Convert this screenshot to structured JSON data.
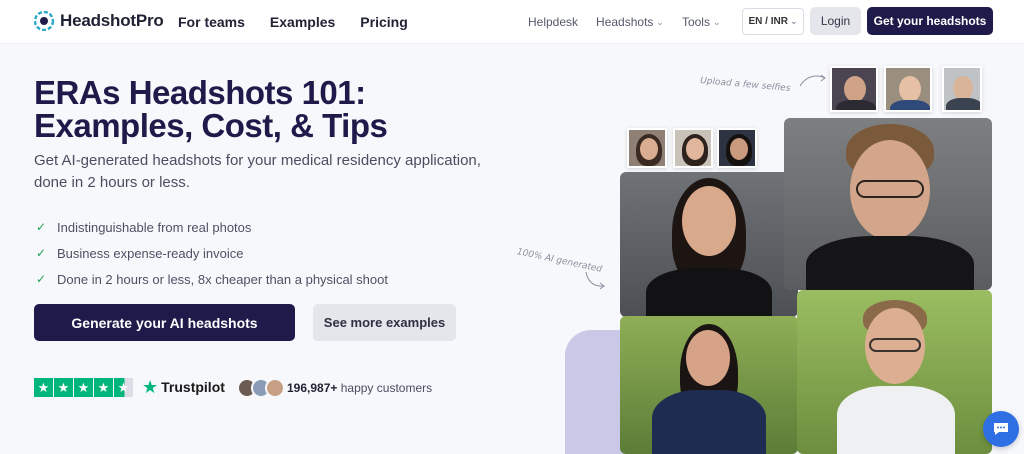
{
  "header": {
    "logo_text": "HeadshotPro",
    "nav_main": [
      "For teams",
      "Examples",
      "Pricing"
    ],
    "nav_right": {
      "helpdesk": "Helpdesk",
      "headshots": "Headshots",
      "tools": "Tools"
    },
    "lang": "EN / INR",
    "login": "Login",
    "cta": "Get your headshots"
  },
  "hero": {
    "title": "ERAs Headshots 101: Examples, Cost, & Tips",
    "subtitle": "Get AI-generated headshots for your medical residency application, done in 2 hours or less.",
    "features": [
      "Indistinguishable from real photos",
      "Business expense-ready invoice",
      "Done in 2 hours or less, 8x cheaper than a physical shoot"
    ],
    "primary_button": "Generate your AI headshots",
    "secondary_button": "See more examples"
  },
  "social_proof": {
    "trustpilot": "Trustpilot",
    "rating_stars": 4.5,
    "customers_count": "196,987+",
    "customers_label": "happy customers"
  },
  "visual": {
    "annotation_upload": "Upload a few selfies",
    "annotation_generated": "100% AI generated"
  },
  "colors": {
    "brand_dark": "#1e1b4b",
    "trustpilot_green": "#00b67a",
    "check_green": "#22a55b",
    "chat_blue": "#2f6fe4"
  },
  "icons": {
    "logo": "aperture-icon",
    "check": "check-icon",
    "chevron": "chevron-down-icon",
    "chat": "chat-bubble-icon",
    "star": "star-icon"
  }
}
